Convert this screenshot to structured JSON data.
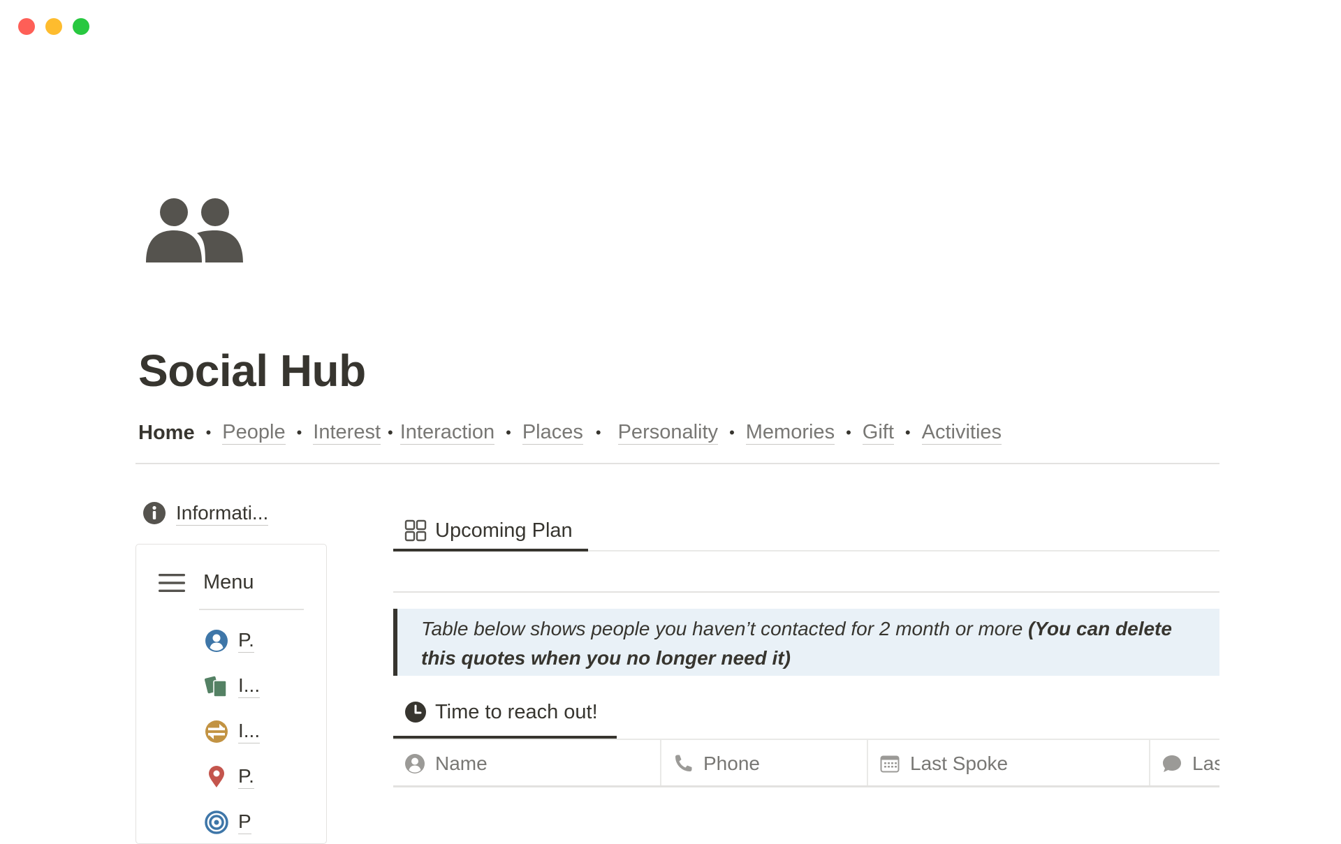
{
  "window": {
    "controls": [
      "close",
      "minimize",
      "zoom"
    ]
  },
  "page": {
    "icon": "people-icon",
    "title": "Social Hub"
  },
  "nav": {
    "home": "Home",
    "separator": "•",
    "links": [
      "People",
      "Interest",
      "Interaction",
      "Places",
      "Personality",
      "Memories",
      "Gift",
      "Activities"
    ]
  },
  "sidebar": {
    "info_label": "Informati...",
    "menu_label": "Menu",
    "items": [
      {
        "label": "P.",
        "icon": "person-circle-icon",
        "color": "#3e76a8"
      },
      {
        "label": "I...",
        "icon": "cards-icon",
        "color": "#548164"
      },
      {
        "label": "I...",
        "icon": "exchange-icon",
        "color": "#c29343"
      },
      {
        "label": "P.",
        "icon": "location-pin-icon",
        "color": "#c4554d"
      },
      {
        "label": "P",
        "icon": "target-icon",
        "color": "#3e76a8"
      }
    ]
  },
  "main": {
    "view_tab": "Upcoming Plan",
    "quote": {
      "italic": "Table below shows people you haven’t contacted for 2 month or more ",
      "bold_italic": "(You can delete this quotes when you no longer need it)"
    },
    "table_tab": "Time to reach out!",
    "columns": [
      {
        "label": "Name",
        "icon": "person-circle-icon"
      },
      {
        "label": "Phone",
        "icon": "phone-icon"
      },
      {
        "label": "Last Spoke",
        "icon": "calendar-icon"
      },
      {
        "label": "Las",
        "icon": "speech-bubble-icon"
      }
    ]
  }
}
